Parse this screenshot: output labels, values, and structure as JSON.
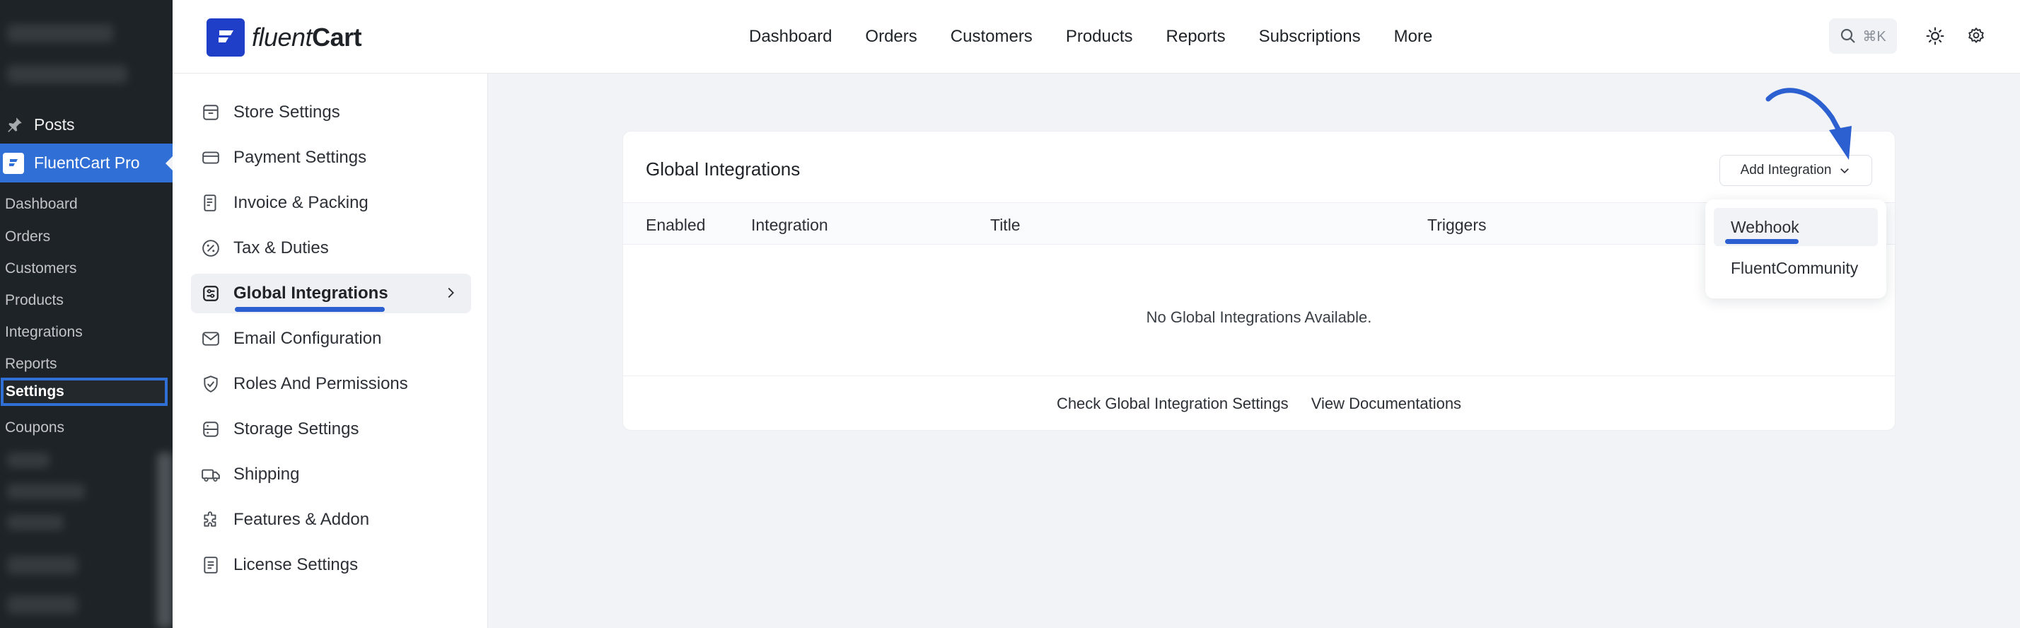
{
  "wp_sidebar": {
    "posts_label": "Posts",
    "plugin_label": "FluentCart Pro",
    "submenu": [
      "Dashboard",
      "Orders",
      "Customers",
      "Products",
      "Integrations",
      "Reports",
      "Settings",
      "Coupons"
    ]
  },
  "brand": {
    "name_light": "fluent",
    "name_bold": "Cart"
  },
  "topnav": [
    "Dashboard",
    "Orders",
    "Customers",
    "Products",
    "Reports",
    "Subscriptions",
    "More"
  ],
  "search": {
    "shortcut": "⌘K"
  },
  "settings_menu": [
    "Store Settings",
    "Payment Settings",
    "Invoice & Packing",
    "Tax & Duties",
    "Global Integrations",
    "Email Configuration",
    "Roles And Permissions",
    "Storage Settings",
    "Shipping",
    "Features & Addon",
    "License Settings"
  ],
  "card": {
    "title": "Global Integrations",
    "add_button": "Add Integration",
    "columns": [
      "Enabled",
      "Integration",
      "Title",
      "Triggers"
    ],
    "empty_message": "No Global Integrations Available.",
    "footer_links": [
      "Check Global Integration Settings",
      "View Documentations"
    ]
  },
  "dropdown": [
    "Webhook",
    "FluentCommunity"
  ],
  "colors": {
    "accent": "#2c5fd0",
    "brand": "#1f3fc9",
    "wp_sidebar": "#1e2327"
  }
}
